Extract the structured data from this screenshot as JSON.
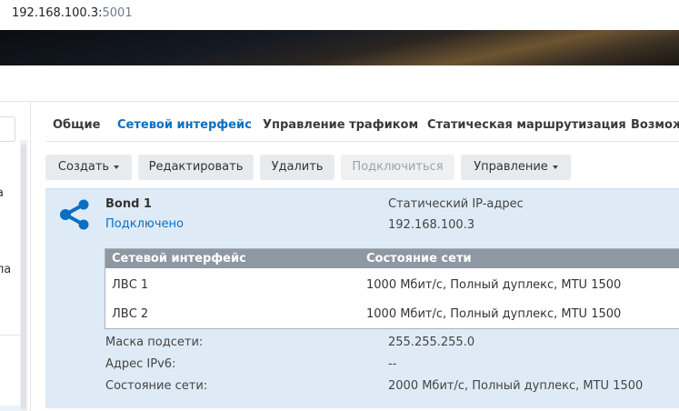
{
  "address_bar": {
    "host": "192.168.100.3:",
    "port": "5001"
  },
  "left_panel": {
    "fragment_1": "а",
    "fragment_2": "ла"
  },
  "tabs": [
    {
      "label": "Общие"
    },
    {
      "label": "Сетевой интерфейс"
    },
    {
      "label": "Управление трафиком"
    },
    {
      "label": "Статическая маршрутизация"
    },
    {
      "label": "Возмож"
    }
  ],
  "toolbar": {
    "create": "Создать",
    "edit": "Редактировать",
    "delete": "Удалить",
    "connect": "Подключиться",
    "manage": "Управление"
  },
  "interface": {
    "icon": "share-icon",
    "name": "Bond 1",
    "status": "Подключено",
    "ip_type": "Статический IP-адрес",
    "ip": "192.168.100.3",
    "table": {
      "headers": [
        "Сетевой интерфейс",
        "Состояние сети"
      ],
      "rows": [
        [
          "ЛВС 1",
          "1000 Мбит/с, Полный дуплекс, MTU 1500"
        ],
        [
          "ЛВС 2",
          "1000 Мбит/с, Полный дуплекс, MTU 1500"
        ]
      ]
    },
    "details": [
      {
        "label": "Маска подсети:",
        "value": "255.255.255.0"
      },
      {
        "label": "Адрес IPv6:",
        "value": "--"
      },
      {
        "label": "Состояние сети:",
        "value": "2000 Мбит/с, Полный дуплекс, MTU 1500"
      }
    ]
  },
  "colors": {
    "accent": "#0a6fc2",
    "panel_bg": "#deebf7",
    "table_header_bg": "#8e98a3"
  }
}
